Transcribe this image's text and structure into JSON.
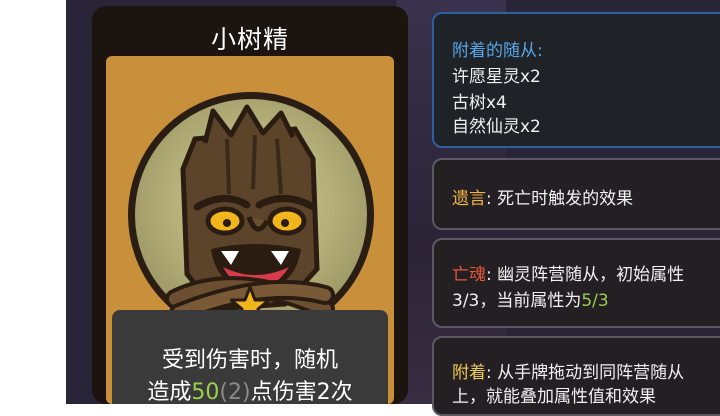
{
  "card": {
    "title": "小树精",
    "description_line1": "受到伤害时，随机",
    "description_line2_pre": "造成",
    "description_line2_value": "50",
    "description_line2_paren": "(2)",
    "description_line2_post": "点伤害2次"
  },
  "attached": {
    "header": "附着的随从:",
    "items": [
      "许愿星灵x2",
      "古树x4",
      "自然仙灵x2"
    ]
  },
  "deathrattle": {
    "keyword": "遗言",
    "text": ": 死亡时触发的效果"
  },
  "soul": {
    "keyword": "亡魂",
    "text_line1": ": 幽灵阵营随从，初始属性",
    "stat_start": "3/3",
    "text_line2_mid": "，当前属性为",
    "stat_current": "5/3"
  },
  "attach": {
    "keyword": "附着",
    "text_line1": ": 从手牌拖动到同阵营随从",
    "text_line2": "上，就能叠加属性值和效果"
  },
  "colors": {
    "card_border": "#c8903a",
    "panel_blue": "#2c5fa0",
    "keyword_orange": "#f2b543",
    "keyword_red": "#e4563a",
    "stat_green": "#9ad04c"
  },
  "icons": {
    "card_star": "star-icon"
  }
}
